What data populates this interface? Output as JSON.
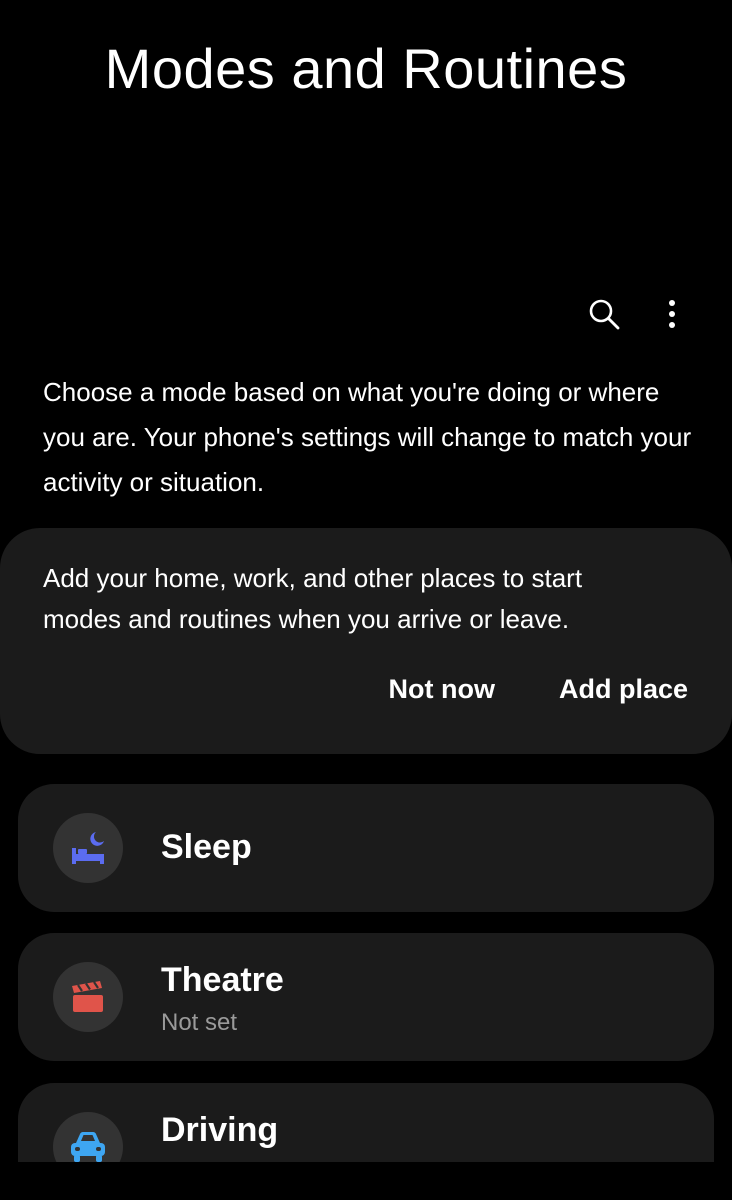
{
  "header": {
    "title": "Modes and Routines"
  },
  "toolbar": {
    "search_icon": "search-icon",
    "more_icon": "more-vertical-icon"
  },
  "intro": {
    "text": "Choose a mode based on what you're doing or where you are. Your phone's settings will change to match your activity or situation."
  },
  "place_card": {
    "text": "Add your home, work, and other places to start modes and routines when you arrive or leave.",
    "not_now_label": "Not now",
    "add_place_label": "Add place"
  },
  "modes": [
    {
      "name": "Sleep",
      "subtitle": "",
      "icon": "bed-moon-icon",
      "color": "#5b6cf0"
    },
    {
      "name": "Theatre",
      "subtitle": "Not set",
      "icon": "clapperboard-icon",
      "color": "#e0544a"
    },
    {
      "name": "Driving",
      "subtitle": "",
      "icon": "car-icon",
      "color": "#3ea6f2"
    }
  ]
}
